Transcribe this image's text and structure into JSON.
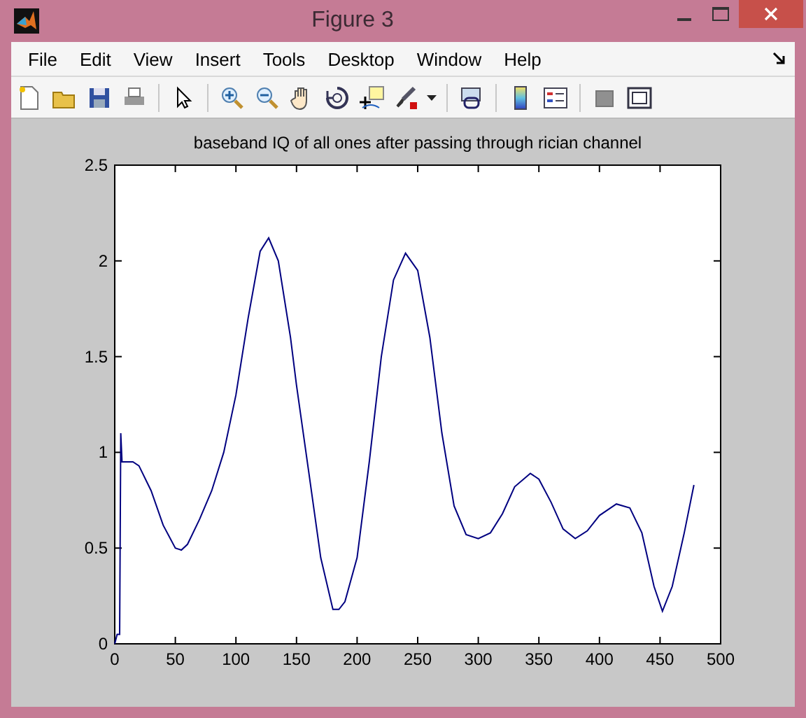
{
  "window": {
    "title": "Figure 3"
  },
  "menu": [
    "File",
    "Edit",
    "View",
    "Insert",
    "Tools",
    "Desktop",
    "Window",
    "Help"
  ],
  "figure": {
    "chart_data": {
      "type": "line",
      "title": "baseband IQ of all ones after passing through rician channel",
      "xlim": [
        0,
        500
      ],
      "ylim": [
        0,
        2.5
      ],
      "xticks": [
        0,
        50,
        100,
        150,
        200,
        250,
        300,
        350,
        400,
        450,
        500
      ],
      "yticks": [
        0,
        0.5,
        1,
        1.5,
        2,
        2.5
      ],
      "x": [
        0,
        2,
        4,
        5,
        6,
        10,
        15,
        20,
        30,
        40,
        50,
        55,
        60,
        70,
        80,
        90,
        100,
        110,
        120,
        127,
        135,
        145,
        150,
        160,
        170,
        180,
        185,
        190,
        200,
        210,
        220,
        230,
        240,
        250,
        260,
        270,
        280,
        290,
        300,
        310,
        320,
        330,
        343,
        350,
        360,
        370,
        380,
        390,
        400,
        414,
        425,
        435,
        445,
        452,
        460,
        470,
        478
      ],
      "series": [
        {
          "color": "#000080",
          "values": [
            0,
            0.05,
            0.05,
            1.1,
            0.95,
            0.95,
            0.95,
            0.93,
            0.8,
            0.62,
            0.5,
            0.49,
            0.52,
            0.65,
            0.8,
            1.0,
            1.3,
            1.7,
            2.05,
            2.12,
            2.0,
            1.6,
            1.35,
            0.9,
            0.45,
            0.18,
            0.18,
            0.22,
            0.45,
            0.95,
            1.5,
            1.9,
            2.04,
            1.95,
            1.6,
            1.1,
            0.72,
            0.57,
            0.55,
            0.58,
            0.68,
            0.82,
            0.89,
            0.86,
            0.74,
            0.6,
            0.55,
            0.59,
            0.67,
            0.73,
            0.71,
            0.58,
            0.3,
            0.17,
            0.3,
            0.58,
            0.83
          ]
        }
      ]
    }
  }
}
